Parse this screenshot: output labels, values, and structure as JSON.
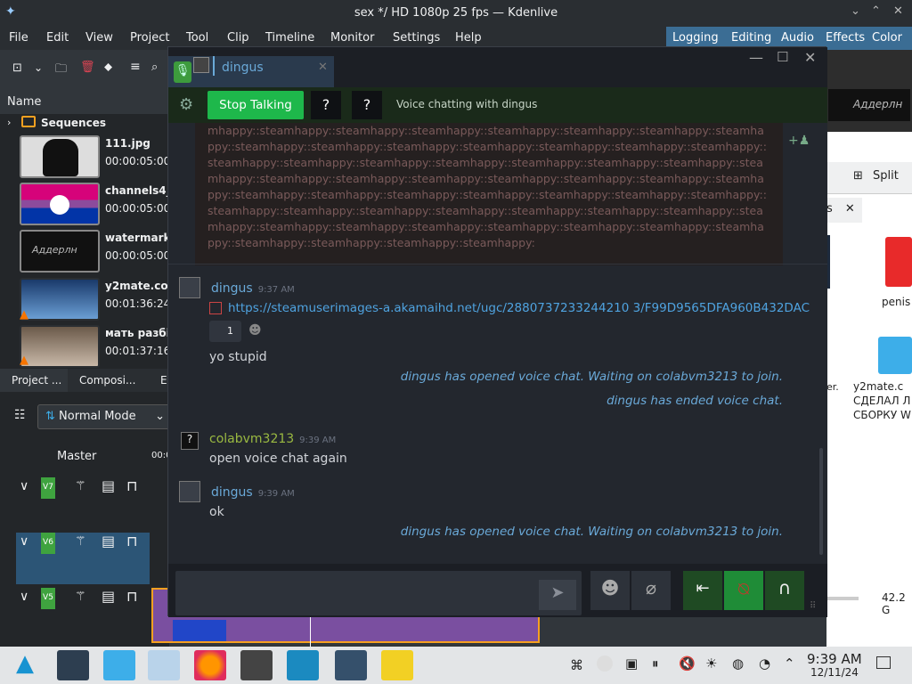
{
  "kdenlive": {
    "title": "sex */ HD 1080p 25 fps — Kdenlive",
    "menu": [
      "File",
      "Edit",
      "View",
      "Project",
      "Tool",
      "Clip",
      "Timeline",
      "Monitor",
      "Settings",
      "Help"
    ],
    "workspaces": [
      "Logging",
      "Editing",
      "Audio",
      "Effects",
      "Color"
    ],
    "bin_header": "Name",
    "sequences_label": "Sequences",
    "clips": [
      {
        "name": "111.jpg",
        "duration": "00:00:05:00"
      },
      {
        "name": "channels4_",
        "duration": "00:00:05:00"
      },
      {
        "name": "watermark",
        "duration": "00:00:05:00"
      },
      {
        "name": "y2mate.co",
        "duration": "00:01:36:24"
      },
      {
        "name": "мать разбі",
        "duration": "00:01:37:16"
      }
    ],
    "bottom_tabs": [
      "Project ...",
      "Composi...",
      "E"
    ],
    "mode": "Normal Mode",
    "master_label": "Master",
    "timecode_fragment": "00:0",
    "tracks": [
      "V7",
      "V6",
      "V5"
    ],
    "split_label": "Split",
    "tab_fragment": "s",
    "watermark_text": "Аддерлн"
  },
  "desktop": {
    "icons": [
      "penis",
      "y2mate.c СДЕЛАЛ Л СБОРКУ W"
    ],
    "fragment": "er.",
    "size_text": "42.2 G"
  },
  "steam": {
    "contact_name": "dingus",
    "stop_talking": "Stop Talking",
    "voice_status": "Voice chatting with dingus",
    "spam_text": "mhappy::steamhappy::steamhappy::steamhappy::steamhappy::steamhappy::steamhappy::steamha ppy::steamhappy::steamhappy::steamhappy::steamhappy::steamhappy::steamhappy::steamhappy:: steamhappy::steamhappy::steamhappy::steamhappy::steamhappy::steamhappy::steamhappy::stea mhappy::steamhappy::steamhappy::steamhappy::steamhappy::steamhappy::steamhappy::steamha ppy::steamhappy::steamhappy::steamhappy::steamhappy::steamhappy::steamhappy::steamhappy:: steamhappy::steamhappy::steamhappy::steamhappy::steamhappy::steamhappy::steamhappy::stea mhappy::steamhappy::steamhappy::steamhappy::steamhappy::steamhappy::steamhappy::steamha ppy::steamhappy::steamhappy::steamhappy::steamhappy:",
    "messages": [
      {
        "author": "dingus",
        "time": "9:37 AM",
        "link": "https://steamuserimages-a.akamaihd.net/ugc/2880737233244210 3/F99D9565DFA960B432DAC",
        "reaction_count": "1",
        "text": "yo stupid"
      },
      {
        "author": "colabvm3213",
        "time": "9:39 AM",
        "text": "open voice chat again"
      },
      {
        "author": "dingus",
        "time": "9:39 AM",
        "text": "ok"
      }
    ],
    "system": [
      "dingus has opened voice chat. Waiting on colabvm3213 to join.",
      "dingus has ended voice chat.",
      "dingus has opened voice chat. Waiting on colabvm3213 to join."
    ],
    "colors": {
      "green": "#1db954",
      "link": "#4fa3e0",
      "friend": "#6aa9d8",
      "self": "#9ab941"
    }
  },
  "taskbar": {
    "time": "9:39 AM",
    "date": "12/11/24"
  }
}
